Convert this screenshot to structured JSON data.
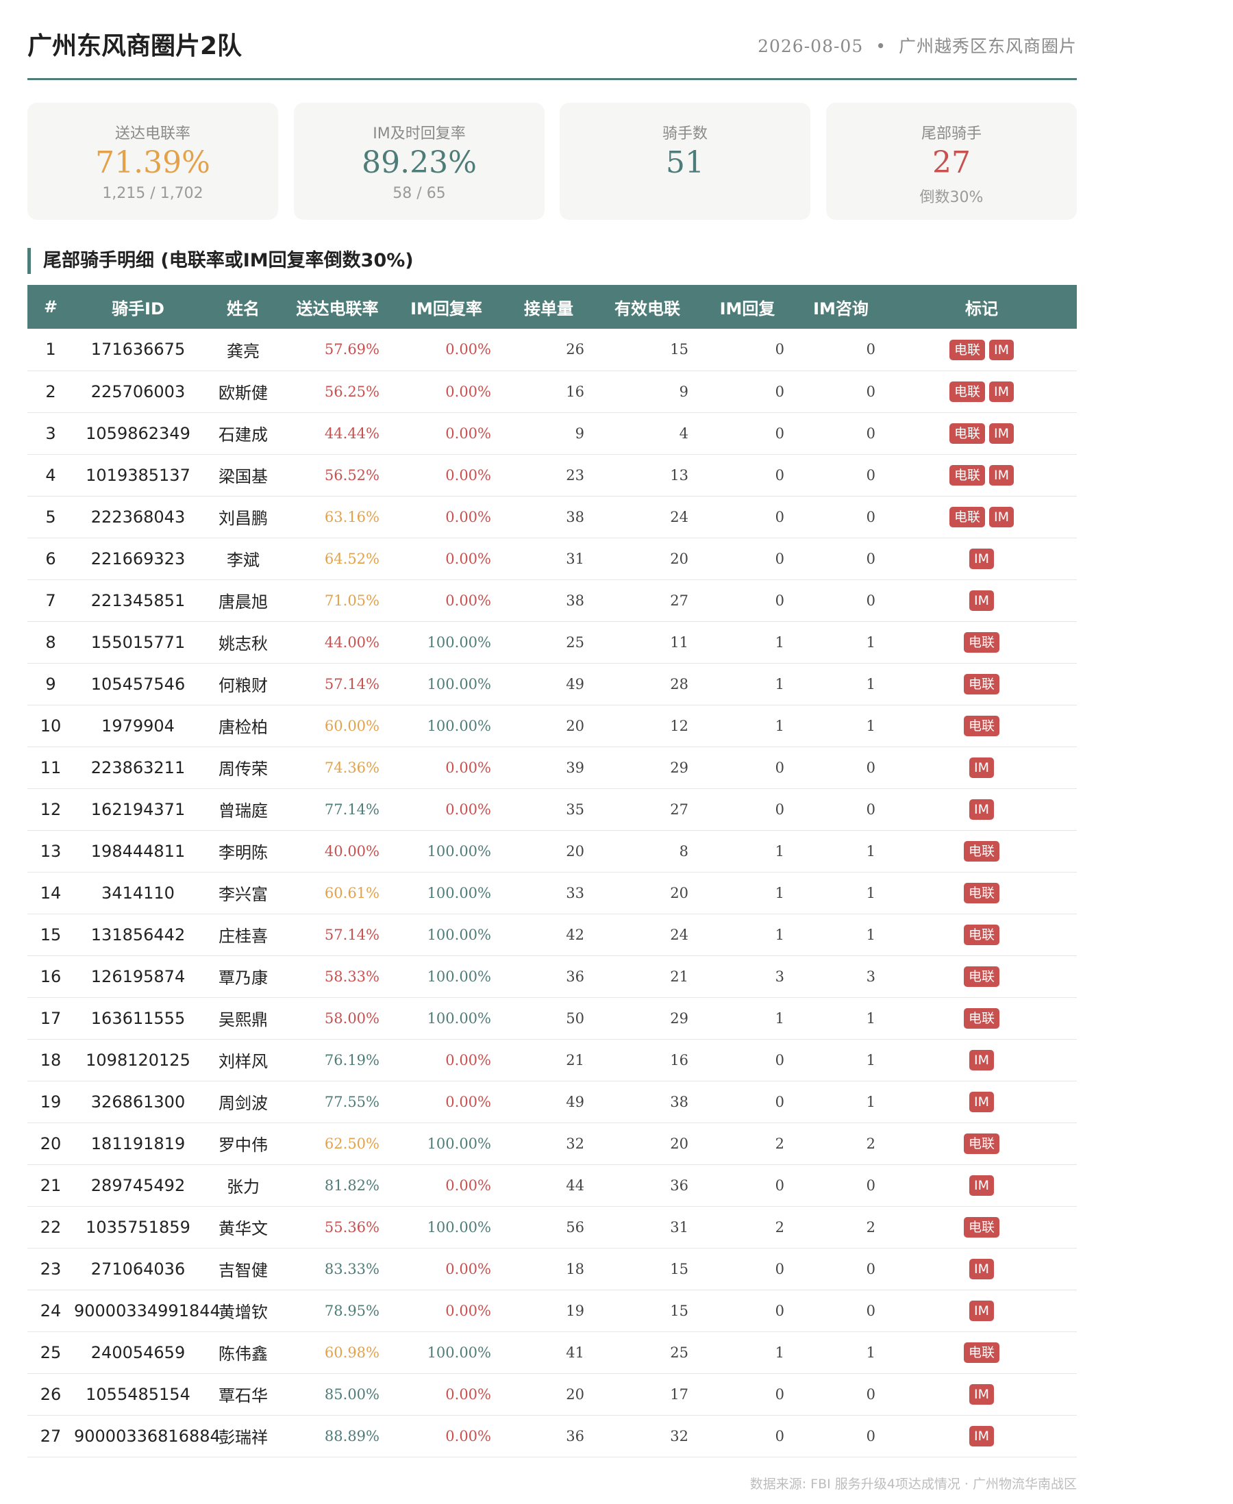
{
  "header": {
    "title": "广州东风商圈片2队",
    "date": "2026-08-05",
    "separator": "•",
    "location": "广州越秀区东风商圈片"
  },
  "cards": [
    {
      "label": "送达电联率",
      "value": "71.39%",
      "sub": "1,215 / 1,702",
      "color": "#e3a24a"
    },
    {
      "label": "IM及时回复率",
      "value": "89.23%",
      "sub": "58 / 65",
      "color": "#4e7c78"
    },
    {
      "label": "骑手数",
      "value": "51",
      "sub": "",
      "color": "#4e7c78"
    },
    {
      "label": "尾部骑手",
      "value": "27",
      "sub": "倒数30%",
      "color": "#c8504f"
    }
  ],
  "section": {
    "title": "尾部骑手明细 (电联率或IM回复率倒数30%)"
  },
  "table": {
    "columns": [
      "#",
      "骑手ID",
      "姓名",
      "送达电联率",
      "IM回复率",
      "接单量",
      "有效电联",
      "IM回复",
      "IM咨询",
      "标记"
    ],
    "rows": [
      {
        "idx": "1",
        "id": "171636675",
        "name": "龚亮",
        "call_rate": "57.69%",
        "call_color": "red",
        "im_rate": "0.00%",
        "im_color": "red",
        "orders": "26",
        "valid_calls": "15",
        "im_reply": "0",
        "im_consult": "0",
        "tags": [
          "电联",
          "IM"
        ]
      },
      {
        "idx": "2",
        "id": "225706003",
        "name": "欧斯健",
        "call_rate": "56.25%",
        "call_color": "red",
        "im_rate": "0.00%",
        "im_color": "red",
        "orders": "16",
        "valid_calls": "9",
        "im_reply": "0",
        "im_consult": "0",
        "tags": [
          "电联",
          "IM"
        ]
      },
      {
        "idx": "3",
        "id": "1059862349",
        "name": "石建成",
        "call_rate": "44.44%",
        "call_color": "red",
        "im_rate": "0.00%",
        "im_color": "red",
        "orders": "9",
        "valid_calls": "4",
        "im_reply": "0",
        "im_consult": "0",
        "tags": [
          "电联",
          "IM"
        ]
      },
      {
        "idx": "4",
        "id": "1019385137",
        "name": "梁国基",
        "call_rate": "56.52%",
        "call_color": "red",
        "im_rate": "0.00%",
        "im_color": "red",
        "orders": "23",
        "valid_calls": "13",
        "im_reply": "0",
        "im_consult": "0",
        "tags": [
          "电联",
          "IM"
        ]
      },
      {
        "idx": "5",
        "id": "222368043",
        "name": "刘昌鹏",
        "call_rate": "63.16%",
        "call_color": "orange",
        "im_rate": "0.00%",
        "im_color": "red",
        "orders": "38",
        "valid_calls": "24",
        "im_reply": "0",
        "im_consult": "0",
        "tags": [
          "电联",
          "IM"
        ]
      },
      {
        "idx": "6",
        "id": "221669323",
        "name": "李斌",
        "call_rate": "64.52%",
        "call_color": "orange",
        "im_rate": "0.00%",
        "im_color": "red",
        "orders": "31",
        "valid_calls": "20",
        "im_reply": "0",
        "im_consult": "0",
        "tags": [
          "IM"
        ]
      },
      {
        "idx": "7",
        "id": "221345851",
        "name": "唐晨旭",
        "call_rate": "71.05%",
        "call_color": "orange",
        "im_rate": "0.00%",
        "im_color": "red",
        "orders": "38",
        "valid_calls": "27",
        "im_reply": "0",
        "im_consult": "0",
        "tags": [
          "IM"
        ]
      },
      {
        "idx": "8",
        "id": "155015771",
        "name": "姚志秋",
        "call_rate": "44.00%",
        "call_color": "red",
        "im_rate": "100.00%",
        "im_color": "teal",
        "orders": "25",
        "valid_calls": "11",
        "im_reply": "1",
        "im_consult": "1",
        "tags": [
          "电联"
        ]
      },
      {
        "idx": "9",
        "id": "105457546",
        "name": "何粮财",
        "call_rate": "57.14%",
        "call_color": "red",
        "im_rate": "100.00%",
        "im_color": "teal",
        "orders": "49",
        "valid_calls": "28",
        "im_reply": "1",
        "im_consult": "1",
        "tags": [
          "电联"
        ]
      },
      {
        "idx": "10",
        "id": "1979904",
        "name": "唐检柏",
        "call_rate": "60.00%",
        "call_color": "orange",
        "im_rate": "100.00%",
        "im_color": "teal",
        "orders": "20",
        "valid_calls": "12",
        "im_reply": "1",
        "im_consult": "1",
        "tags": [
          "电联"
        ]
      },
      {
        "idx": "11",
        "id": "223863211",
        "name": "周传荣",
        "call_rate": "74.36%",
        "call_color": "orange",
        "im_rate": "0.00%",
        "im_color": "red",
        "orders": "39",
        "valid_calls": "29",
        "im_reply": "0",
        "im_consult": "0",
        "tags": [
          "IM"
        ]
      },
      {
        "idx": "12",
        "id": "162194371",
        "name": "曾瑞庭",
        "call_rate": "77.14%",
        "call_color": "teal",
        "im_rate": "0.00%",
        "im_color": "red",
        "orders": "35",
        "valid_calls": "27",
        "im_reply": "0",
        "im_consult": "0",
        "tags": [
          "IM"
        ]
      },
      {
        "idx": "13",
        "id": "198444811",
        "name": "李明陈",
        "call_rate": "40.00%",
        "call_color": "red",
        "im_rate": "100.00%",
        "im_color": "teal",
        "orders": "20",
        "valid_calls": "8",
        "im_reply": "1",
        "im_consult": "1",
        "tags": [
          "电联"
        ]
      },
      {
        "idx": "14",
        "id": "3414110",
        "name": "李兴富",
        "call_rate": "60.61%",
        "call_color": "orange",
        "im_rate": "100.00%",
        "im_color": "teal",
        "orders": "33",
        "valid_calls": "20",
        "im_reply": "1",
        "im_consult": "1",
        "tags": [
          "电联"
        ]
      },
      {
        "idx": "15",
        "id": "131856442",
        "name": "庄桂喜",
        "call_rate": "57.14%",
        "call_color": "red",
        "im_rate": "100.00%",
        "im_color": "teal",
        "orders": "42",
        "valid_calls": "24",
        "im_reply": "1",
        "im_consult": "1",
        "tags": [
          "电联"
        ]
      },
      {
        "idx": "16",
        "id": "126195874",
        "name": "覃乃康",
        "call_rate": "58.33%",
        "call_color": "red",
        "im_rate": "100.00%",
        "im_color": "teal",
        "orders": "36",
        "valid_calls": "21",
        "im_reply": "3",
        "im_consult": "3",
        "tags": [
          "电联"
        ]
      },
      {
        "idx": "17",
        "id": "163611555",
        "name": "吴熙鼎",
        "call_rate": "58.00%",
        "call_color": "red",
        "im_rate": "100.00%",
        "im_color": "teal",
        "orders": "50",
        "valid_calls": "29",
        "im_reply": "1",
        "im_consult": "1",
        "tags": [
          "电联"
        ]
      },
      {
        "idx": "18",
        "id": "1098120125",
        "name": "刘样风",
        "call_rate": "76.19%",
        "call_color": "teal",
        "im_rate": "0.00%",
        "im_color": "red",
        "orders": "21",
        "valid_calls": "16",
        "im_reply": "0",
        "im_consult": "1",
        "tags": [
          "IM"
        ]
      },
      {
        "idx": "19",
        "id": "326861300",
        "name": "周剑波",
        "call_rate": "77.55%",
        "call_color": "teal",
        "im_rate": "0.00%",
        "im_color": "red",
        "orders": "49",
        "valid_calls": "38",
        "im_reply": "0",
        "im_consult": "1",
        "tags": [
          "IM"
        ]
      },
      {
        "idx": "20",
        "id": "181191819",
        "name": "罗中伟",
        "call_rate": "62.50%",
        "call_color": "orange",
        "im_rate": "100.00%",
        "im_color": "teal",
        "orders": "32",
        "valid_calls": "20",
        "im_reply": "2",
        "im_consult": "2",
        "tags": [
          "电联"
        ]
      },
      {
        "idx": "21",
        "id": "289745492",
        "name": "张力",
        "call_rate": "81.82%",
        "call_color": "teal",
        "im_rate": "0.00%",
        "im_color": "red",
        "orders": "44",
        "valid_calls": "36",
        "im_reply": "0",
        "im_consult": "0",
        "tags": [
          "IM"
        ]
      },
      {
        "idx": "22",
        "id": "1035751859",
        "name": "黄华文",
        "call_rate": "55.36%",
        "call_color": "red",
        "im_rate": "100.00%",
        "im_color": "teal",
        "orders": "56",
        "valid_calls": "31",
        "im_reply": "2",
        "im_consult": "2",
        "tags": [
          "电联"
        ]
      },
      {
        "idx": "23",
        "id": "271064036",
        "name": "吉智健",
        "call_rate": "83.33%",
        "call_color": "teal",
        "im_rate": "0.00%",
        "im_color": "red",
        "orders": "18",
        "valid_calls": "15",
        "im_reply": "0",
        "im_consult": "0",
        "tags": [
          "IM"
        ]
      },
      {
        "idx": "24",
        "id": "90000334991844",
        "name": "黄增钦",
        "call_rate": "78.95%",
        "call_color": "teal",
        "im_rate": "0.00%",
        "im_color": "red",
        "orders": "19",
        "valid_calls": "15",
        "im_reply": "0",
        "im_consult": "0",
        "tags": [
          "IM"
        ]
      },
      {
        "idx": "25",
        "id": "240054659",
        "name": "陈伟鑫",
        "call_rate": "60.98%",
        "call_color": "orange",
        "im_rate": "100.00%",
        "im_color": "teal",
        "orders": "41",
        "valid_calls": "25",
        "im_reply": "1",
        "im_consult": "1",
        "tags": [
          "电联"
        ]
      },
      {
        "idx": "26",
        "id": "1055485154",
        "name": "覃石华",
        "call_rate": "85.00%",
        "call_color": "teal",
        "im_rate": "0.00%",
        "im_color": "red",
        "orders": "20",
        "valid_calls": "17",
        "im_reply": "0",
        "im_consult": "0",
        "tags": [
          "IM"
        ]
      },
      {
        "idx": "27",
        "id": "90000336816884",
        "name": "彭瑞祥",
        "call_rate": "88.89%",
        "call_color": "teal",
        "im_rate": "0.00%",
        "im_color": "red",
        "orders": "36",
        "valid_calls": "32",
        "im_reply": "0",
        "im_consult": "0",
        "tags": [
          "IM"
        ]
      }
    ]
  },
  "footer": {
    "text": "数据来源: FBI 服务升级4项达成情况 · 广州物流华南战区"
  }
}
